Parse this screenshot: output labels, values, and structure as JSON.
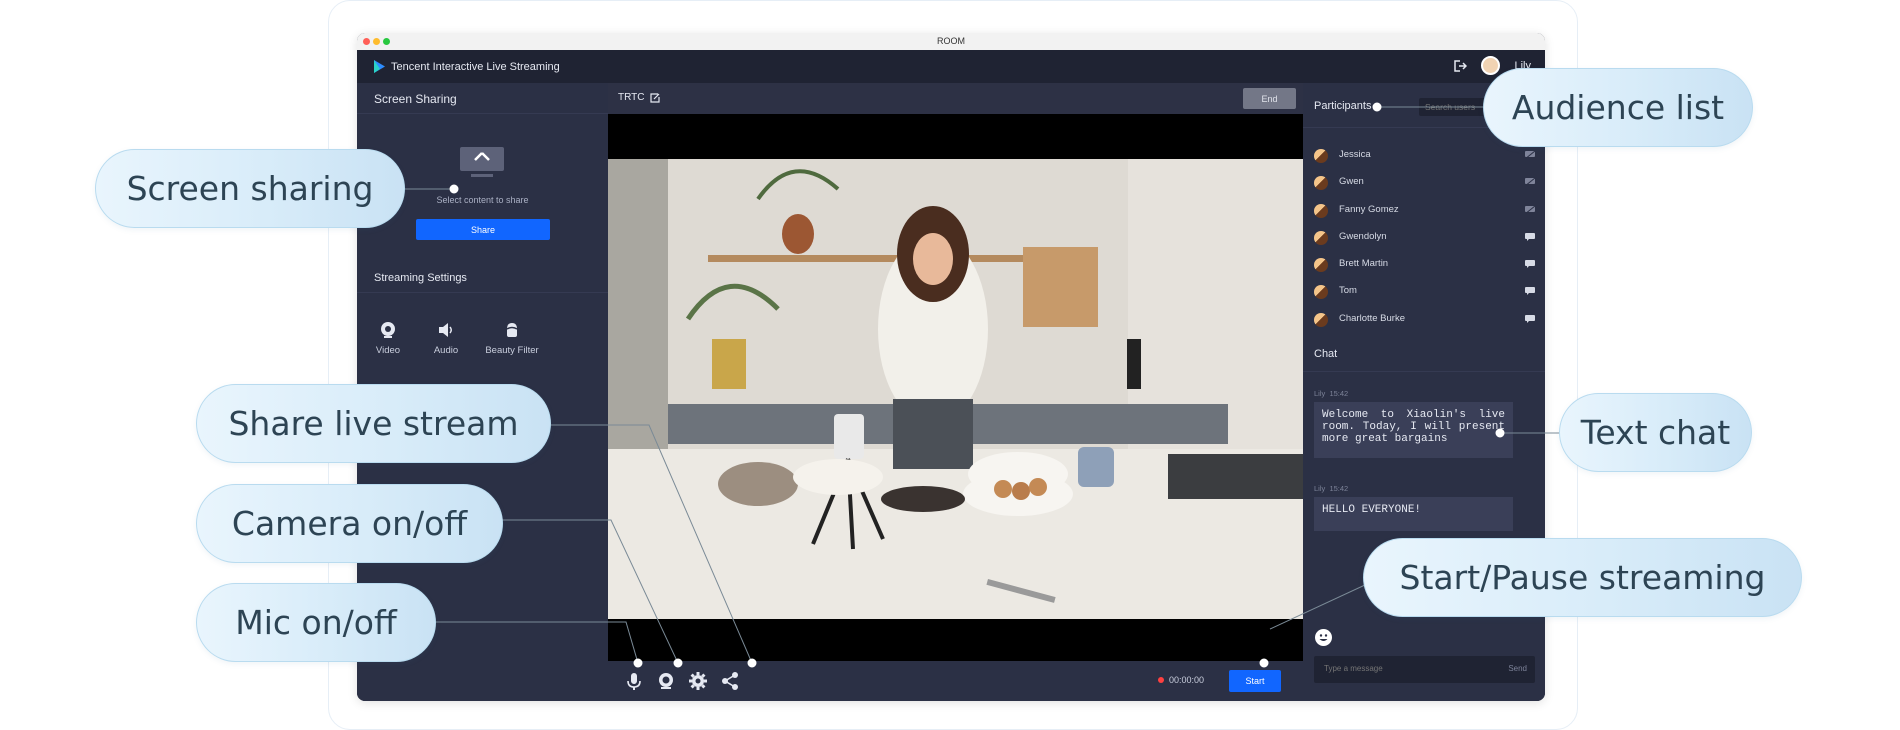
{
  "window": {
    "title": "ROOM"
  },
  "app": {
    "name": "Tencent Interactive Live Streaming",
    "user": "Lily"
  },
  "left_panel": {
    "screen_sharing_title": "Screen Sharing",
    "share_hint": "Select content to share",
    "share_button": "Share",
    "streaming_settings_title": "Streaming Settings",
    "settings": [
      {
        "label": "Video",
        "icon": "camera-icon"
      },
      {
        "label": "Audio",
        "icon": "speaker-icon"
      },
      {
        "label": "Beauty Filter",
        "icon": "beauty-filter-icon"
      }
    ]
  },
  "stage": {
    "room_name": "TRTC",
    "end_button": "End",
    "timer": "00:00:00",
    "start_button": "Start",
    "controls": [
      "mic-icon",
      "camera-icon",
      "settings-icon",
      "share-icon"
    ]
  },
  "right_panel": {
    "participants_title": "Participants",
    "search_placeholder": "Search users",
    "participants": [
      {
        "name": "Jessica",
        "status": "mic-muted-icon"
      },
      {
        "name": "Gwen",
        "status": "mic-muted-icon"
      },
      {
        "name": "Fanny Gomez",
        "status": "mic-muted-icon"
      },
      {
        "name": "Gwendolyn",
        "status": "chat-icon"
      },
      {
        "name": "Brett Martin",
        "status": "chat-icon"
      },
      {
        "name": "Tom",
        "status": "chat-icon"
      },
      {
        "name": "Charlotte Burke",
        "status": "chat-icon"
      }
    ],
    "chat_title": "Chat",
    "messages": [
      {
        "user": "Lily",
        "time": "15:42",
        "text": "Welcome to Xiaolin's live room. Today, I will present more great bargains"
      },
      {
        "user": "Lily",
        "time": "15:42",
        "text": "HELLO EVERYONE!"
      }
    ],
    "message_placeholder": "Type a message",
    "send_label": "Send"
  },
  "callouts": {
    "screen_sharing": "Screen sharing",
    "share_live_stream": "Share live stream",
    "camera": "Camera on/off",
    "mic": "Mic on/off",
    "audience_list": "Audience list",
    "text_chat": "Text chat",
    "start_pause": "Start/Pause streaming"
  },
  "colors": {
    "accent": "#1166ff",
    "panel": "#2b3045",
    "appbar": "#1f2333",
    "callout": "#d8ecf9"
  }
}
